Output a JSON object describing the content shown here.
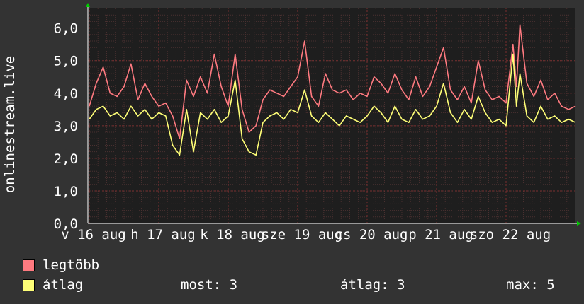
{
  "chart_data": {
    "type": "line",
    "ylabel": "onlinestream.live",
    "ylim": [
      0,
      6.6
    ],
    "yticks": [
      0,
      1,
      2,
      3,
      4,
      5,
      6
    ],
    "ytick_labels": [
      "0,0",
      "1,0",
      "2,0",
      "3,0",
      "4,0",
      "5,0",
      "6,0"
    ],
    "xlim": [
      15.98,
      23.0
    ],
    "x_tick_labels": [
      "v 16 aug",
      "h 17 aug",
      "k 18 aug",
      "sze 19 aug",
      "cs 20 aug",
      "p 21 aug",
      "szo 22 aug"
    ],
    "x_tick_positions": [
      16,
      17,
      18,
      19,
      20,
      21,
      22
    ],
    "grid": true,
    "colors": {
      "background": "#333333",
      "plot_background": "#1e1e1e",
      "grid_major": "#7a3030",
      "grid_minor": "#4a3030",
      "axis": "#ffffff",
      "arrow": "#00cc00"
    },
    "series": [
      {
        "name": "legtöbb",
        "color": "#ff7a80",
        "x": [
          16.0,
          16.1,
          16.2,
          16.3,
          16.4,
          16.5,
          16.6,
          16.7,
          16.8,
          16.9,
          17.0,
          17.1,
          17.2,
          17.3,
          17.4,
          17.5,
          17.6,
          17.7,
          17.8,
          17.9,
          18.0,
          18.1,
          18.2,
          18.3,
          18.4,
          18.5,
          18.6,
          18.7,
          18.8,
          18.9,
          19.0,
          19.1,
          19.2,
          19.3,
          19.4,
          19.5,
          19.6,
          19.7,
          19.8,
          19.9,
          20.0,
          20.1,
          20.2,
          20.3,
          20.4,
          20.5,
          20.6,
          20.7,
          20.8,
          20.9,
          21.0,
          21.1,
          21.2,
          21.3,
          21.4,
          21.5,
          21.6,
          21.7,
          21.8,
          21.9,
          22.0,
          22.1,
          22.15,
          22.2,
          22.3,
          22.4,
          22.5,
          22.6,
          22.7,
          22.8,
          22.9,
          23.0
        ],
        "values": [
          3.6,
          4.3,
          4.8,
          4.0,
          3.9,
          4.2,
          4.9,
          3.8,
          4.3,
          3.9,
          3.6,
          3.7,
          3.3,
          2.6,
          4.4,
          3.9,
          4.5,
          4.0,
          5.2,
          4.2,
          3.6,
          5.2,
          3.5,
          2.8,
          3.0,
          3.8,
          4.1,
          4.0,
          3.9,
          4.2,
          4.5,
          5.6,
          3.9,
          3.6,
          4.6,
          4.1,
          4.0,
          4.1,
          3.8,
          4.0,
          3.9,
          4.5,
          4.3,
          4.0,
          4.6,
          4.1,
          3.8,
          4.5,
          3.9,
          4.2,
          4.8,
          5.4,
          4.1,
          3.8,
          4.2,
          3.7,
          5.0,
          4.1,
          3.8,
          3.9,
          3.7,
          5.5,
          4.2,
          6.1,
          4.3,
          3.9,
          4.4,
          3.8,
          4.0,
          3.6,
          3.5,
          3.6
        ]
      },
      {
        "name": "átlag",
        "color": "#ffff77",
        "x": [
          16.0,
          16.1,
          16.2,
          16.3,
          16.4,
          16.5,
          16.6,
          16.7,
          16.8,
          16.9,
          17.0,
          17.1,
          17.2,
          17.3,
          17.4,
          17.5,
          17.6,
          17.7,
          17.8,
          17.9,
          18.0,
          18.1,
          18.2,
          18.3,
          18.4,
          18.5,
          18.6,
          18.7,
          18.8,
          18.9,
          19.0,
          19.1,
          19.2,
          19.3,
          19.4,
          19.5,
          19.6,
          19.7,
          19.8,
          19.9,
          20.0,
          20.1,
          20.2,
          20.3,
          20.4,
          20.5,
          20.6,
          20.7,
          20.8,
          20.9,
          21.0,
          21.1,
          21.2,
          21.3,
          21.4,
          21.5,
          21.6,
          21.7,
          21.8,
          21.9,
          22.0,
          22.1,
          22.15,
          22.2,
          22.3,
          22.4,
          22.5,
          22.6,
          22.7,
          22.8,
          22.9,
          23.0
        ],
        "values": [
          3.2,
          3.5,
          3.6,
          3.3,
          3.4,
          3.2,
          3.6,
          3.3,
          3.5,
          3.2,
          3.4,
          3.3,
          2.4,
          2.1,
          3.5,
          2.2,
          3.4,
          3.2,
          3.5,
          3.1,
          3.3,
          4.4,
          2.6,
          2.2,
          2.1,
          3.1,
          3.3,
          3.4,
          3.2,
          3.5,
          3.4,
          4.1,
          3.3,
          3.1,
          3.4,
          3.2,
          3.0,
          3.3,
          3.2,
          3.1,
          3.3,
          3.6,
          3.4,
          3.1,
          3.6,
          3.2,
          3.1,
          3.5,
          3.2,
          3.3,
          3.6,
          4.3,
          3.4,
          3.1,
          3.5,
          3.2,
          3.9,
          3.4,
          3.1,
          3.2,
          3.0,
          5.2,
          3.6,
          4.6,
          3.3,
          3.1,
          3.6,
          3.2,
          3.3,
          3.1,
          3.2,
          3.1
        ]
      }
    ],
    "legend": [
      {
        "label": "legtöbb",
        "color": "#ff7a80"
      },
      {
        "label": "átlag",
        "color": "#ffff77"
      }
    ],
    "stats": {
      "most": "most: 3",
      "atlag": "átlag: 3",
      "max": "max: 5"
    }
  }
}
